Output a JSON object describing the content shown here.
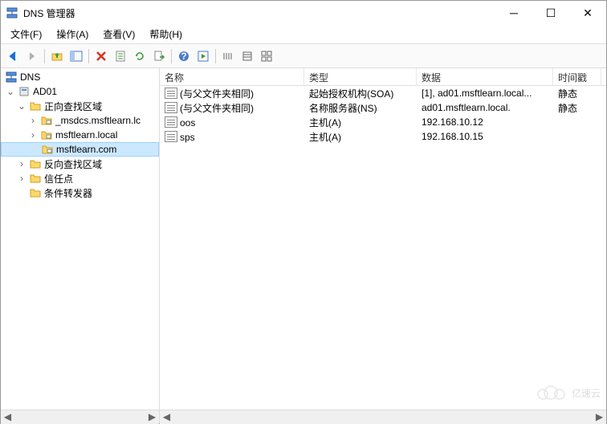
{
  "window": {
    "title": "DNS 管理器"
  },
  "menu": {
    "file": "文件(F)",
    "action": "操作(A)",
    "view": "查看(V)",
    "help": "帮助(H)"
  },
  "tree": {
    "root": "DNS",
    "server": "AD01",
    "fwd": "正向查找区域",
    "fwd_items": [
      "_msdcs.msftlearn.lc",
      "msftlearn.local",
      "msftlearn.com"
    ],
    "rev": "反向查找区域",
    "trust": "信任点",
    "cond": "条件转发器"
  },
  "list": {
    "headers": {
      "name": "名称",
      "type": "类型",
      "data": "数据",
      "ts": "时间戳"
    },
    "rows": [
      {
        "name": "(与父文件夹相同)",
        "type": "起始授权机构(SOA)",
        "data": "[1], ad01.msftlearn.local...",
        "ts": "静态"
      },
      {
        "name": "(与父文件夹相同)",
        "type": "名称服务器(NS)",
        "data": "ad01.msftlearn.local.",
        "ts": "静态"
      },
      {
        "name": "oos",
        "type": "主机(A)",
        "data": "192.168.10.12",
        "ts": ""
      },
      {
        "name": "sps",
        "type": "主机(A)",
        "data": "192.168.10.15",
        "ts": ""
      }
    ]
  },
  "watermark": "亿速云"
}
